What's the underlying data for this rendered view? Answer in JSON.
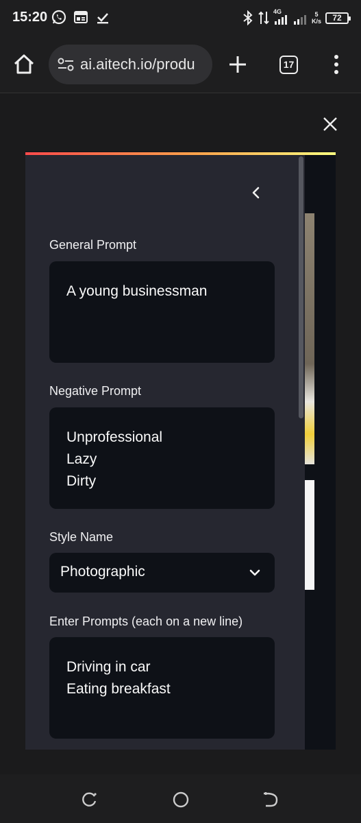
{
  "status_bar": {
    "time": "15:20",
    "network_label": "4G",
    "speed_value": "5",
    "speed_unit": "K/s",
    "battery": "72"
  },
  "browser": {
    "url": "ai.aitech.io/produ",
    "tab_count": "17"
  },
  "sidebar": {
    "general_prompt": {
      "label": "General Prompt",
      "value": "A young businessman"
    },
    "negative_prompt": {
      "label": "Negative Prompt",
      "value": "Unprofessional\nLazy\nDirty"
    },
    "style_name": {
      "label": "Style Name",
      "selected": "Photographic"
    },
    "prompts": {
      "label": "Enter Prompts (each on a new line)",
      "value": "Driving in car\nEating breakfast"
    }
  },
  "colors": {
    "app_background": "#0e1117",
    "sidebar_background": "#262730",
    "gradient_start": "#ff4b4b",
    "gradient_end": "#fffd80"
  }
}
